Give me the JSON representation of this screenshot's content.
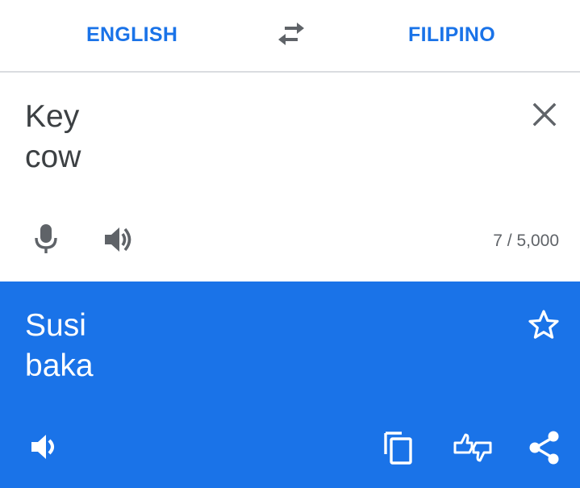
{
  "language_bar": {
    "source_language": "ENGLISH",
    "target_language": "FILIPINO",
    "swap_icon": "swap-horiz-icon"
  },
  "input": {
    "text": "Key\ncow",
    "char_count": "7 / 5,000",
    "icons": {
      "clear": "close-icon",
      "mic": "microphone-icon",
      "speak": "speaker-icon"
    }
  },
  "output": {
    "text": "Susi\nbaka",
    "icons": {
      "star": "star-outline-icon",
      "speak": "speaker-icon",
      "copy": "copy-icon",
      "feedback": "feedback-thumbs-icon",
      "share": "share-icon"
    }
  },
  "colors": {
    "accent": "#1a73e8",
    "text_dark": "#3c4043",
    "icon_gray": "#5f6368",
    "divider": "#dadce0",
    "output_text": "#ffffff"
  }
}
